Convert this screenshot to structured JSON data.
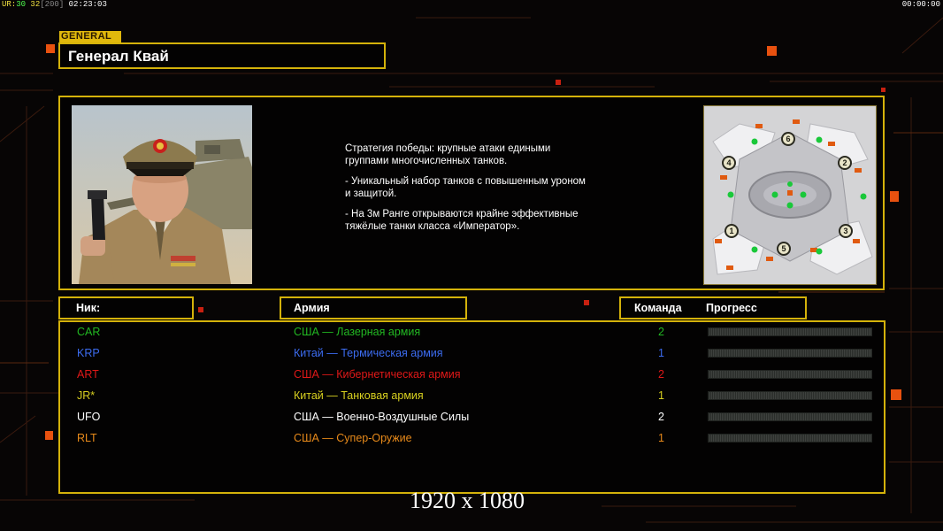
{
  "hud": {
    "stats": [
      {
        "text": "UR:",
        "color": "#f0e040"
      },
      {
        "text": "30",
        "color": "#50ff50"
      },
      {
        "text": "32",
        "color": "#f0e040"
      },
      {
        "text": "[200]",
        "color": "#888888"
      },
      {
        "text": "02:23:03",
        "color": "#ffffff"
      }
    ],
    "clock": "00:00:00"
  },
  "general": {
    "tag": "GENERAL",
    "name": "Генерал Квай",
    "strategy": [
      "Стратегия победы: крупные атаки едиными\n группами многочисленных танков.",
      "- Уникальный набор танков с повышенным уроном\n и защитой.",
      "- На 3м Ранге открываются крайне эффективные\n тяжёлые танки класса «Император»."
    ]
  },
  "map": {
    "spawns": [
      "1",
      "2",
      "3",
      "4",
      "5",
      "6"
    ]
  },
  "table": {
    "headers": {
      "nick": "Ник:",
      "army": "Армия",
      "team": "Команда",
      "progress": "Прогресс"
    },
    "rows": [
      {
        "nick": "CAR",
        "army": "США — Лазерная армия",
        "team": "2",
        "color": "#22b822",
        "progress": 0
      },
      {
        "nick": "KRP",
        "army": "Китай — Термическая армия",
        "team": "1",
        "color": "#3c6cf0",
        "progress": 0
      },
      {
        "nick": "ART",
        "army": "США — Кибернетическая армия",
        "team": "2",
        "color": "#e01818",
        "progress": 0
      },
      {
        "nick": "JR*",
        "army": "Китай — Танковая армия",
        "team": "1",
        "color": "#d8d020",
        "progress": 0
      },
      {
        "nick": "UFO",
        "army": "США — Военно-Воздушные Силы",
        "team": "2",
        "color": "#ffffff",
        "progress": 0
      },
      {
        "nick": "RLT",
        "army": "США — Супер-Оружие",
        "team": "1",
        "color": "#e88a1a",
        "progress": 0
      }
    ]
  },
  "resolution": "1920 x 1080"
}
